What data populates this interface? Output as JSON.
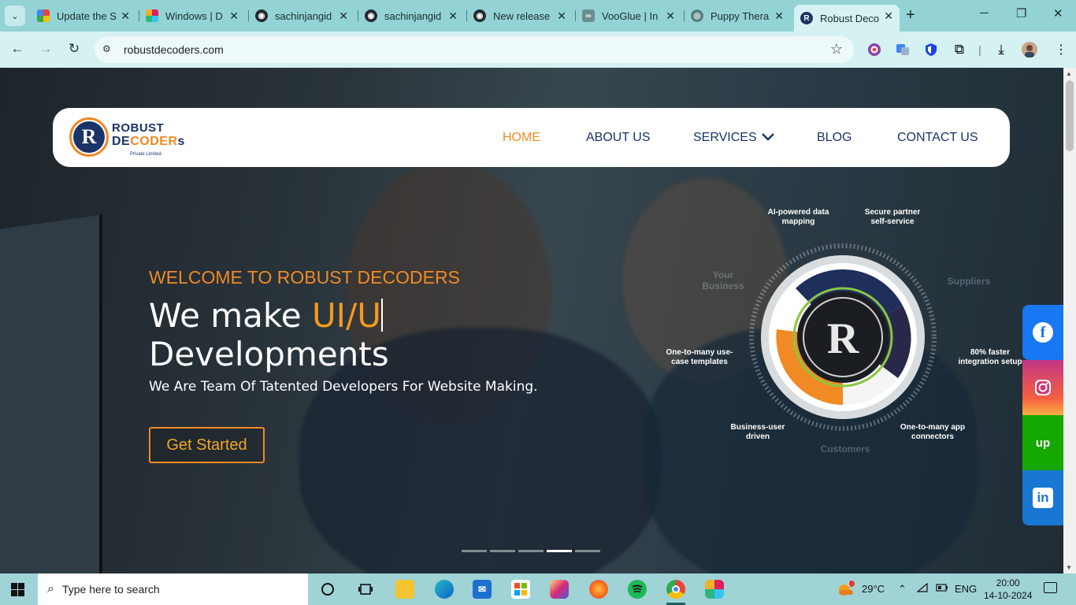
{
  "browser": {
    "tabs": [
      {
        "title": "Update the S",
        "fav_color": "#ea4335",
        "fav_glyph": ""
      },
      {
        "title": "Windows | D",
        "fav_color": "#e01e5a",
        "fav_glyph": ""
      },
      {
        "title": "sachinjangid",
        "fav_color": "#24292f",
        "fav_glyph": "◉"
      },
      {
        "title": "sachinjangid",
        "fav_color": "#24292f",
        "fav_glyph": "◉"
      },
      {
        "title": "New release",
        "fav_color": "#24292f",
        "fav_glyph": "◉"
      },
      {
        "title": "VooGlue | In",
        "fav_color": "#6b8e8f",
        "fav_glyph": "∞"
      },
      {
        "title": "Puppy Thera",
        "fav_color": "#5a7f80",
        "fav_glyph": "◎"
      },
      {
        "title": "Robust Deco",
        "fav_color": "#1a3468",
        "fav_glyph": "R"
      }
    ],
    "new_tab": "+",
    "minimize": "─",
    "restore": "❐",
    "close": "✕",
    "url": "robustdecoders.com"
  },
  "site": {
    "logo": {
      "line1": "ROBUST",
      "line2a": "DE",
      "line2b": "CODE",
      "line2c": "R",
      "line2d": "s",
      "line3": "Private Limited",
      "mark": "R"
    },
    "nav": {
      "home": "HOME",
      "about": "ABOUT US",
      "services": "SERVICES",
      "blog": "BLOG",
      "contact": "CONTACT US"
    },
    "hero": {
      "welcome": "WELCOME TO ROBUST DECODERS",
      "h1_prefix": "We make ",
      "h1_highlight": "UI/U",
      "h1_line2": "Developments",
      "desc": "We Are Team Of Tatented Developers For Website Making.",
      "cta": "Get Started"
    },
    "diagram": {
      "ai": "AI-powered data mapping",
      "secure": "Secure partner self-service",
      "one_many": "One-to-many use-case templates",
      "faster": "80% faster integration setup",
      "business": "Business-user driven",
      "connectors": "One-to-many app connectors",
      "your_business": "Your Business",
      "suppliers": "Suppliers",
      "customers": "Customers"
    },
    "carousel": {
      "count": 5,
      "active_index": 3
    },
    "social": {
      "facebook": "f",
      "upwork": "up",
      "linkedin": "in"
    }
  },
  "taskbar": {
    "search_placeholder": "Type here to search",
    "weather": "29°C",
    "weather_badge": "1",
    "lang": "ENG",
    "time": "20:00",
    "date": "14-10-2024"
  },
  "colors": {
    "accent_orange": "#f08a24",
    "brand_navy": "#1a3468",
    "facebook": "#1877f2",
    "upwork": "#14a800",
    "linkedin": "#1877d2"
  }
}
